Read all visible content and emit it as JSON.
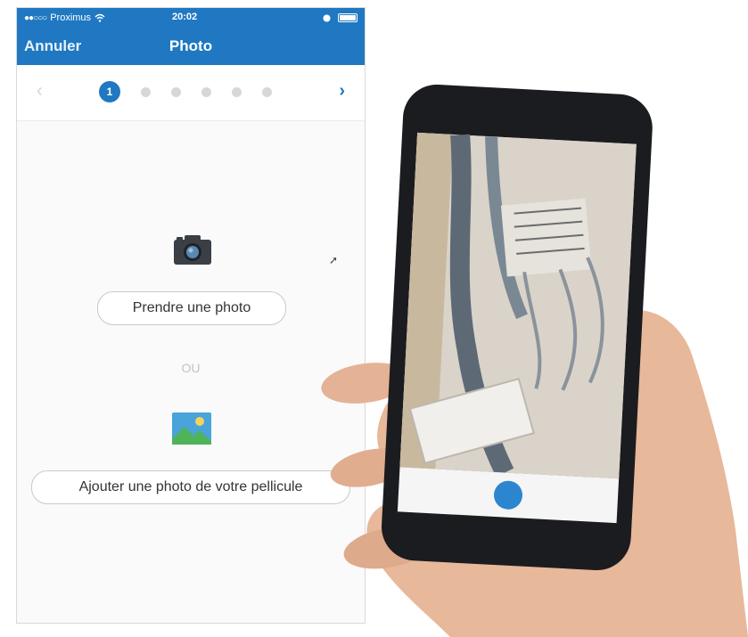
{
  "status_bar": {
    "carrier": "Proximus",
    "time": "20:02"
  },
  "nav": {
    "cancel_label": "Annuler",
    "title": "Photo"
  },
  "pager": {
    "steps": [
      "1",
      "",
      "",
      "",
      "",
      ""
    ],
    "active_step": 1,
    "prev_icon": "chevron-left-icon",
    "next_icon": "chevron-right-icon"
  },
  "actions": {
    "take_photo_label": "Prendre une photo",
    "or_label": "OU",
    "add_from_roll_label": "Ajouter une photo de votre pellicule"
  },
  "icons": {
    "camera": "camera-icon",
    "image": "image-icon",
    "wifi": "wifi-icon",
    "battery": "battery-icon"
  },
  "colors": {
    "brand_blue": "#1f78c1",
    "inactive_dot": "#d7d7d7",
    "button_border": "#c9c9c9"
  }
}
